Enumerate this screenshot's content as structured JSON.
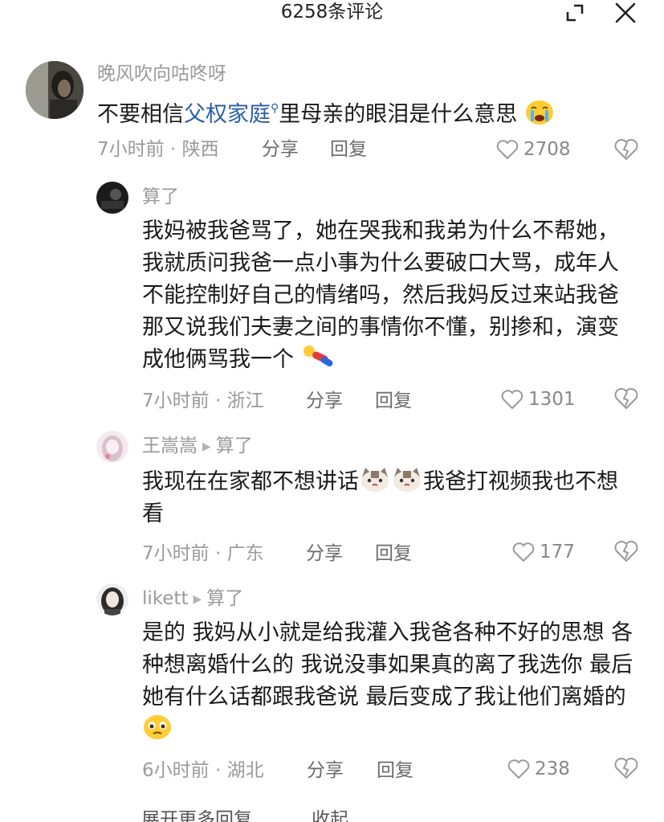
{
  "header": {
    "title": "6258条评论"
  },
  "comments": [
    {
      "user": "晚风吹向咕咚呀",
      "text_before": "不要相信",
      "keyword": "父权家庭",
      "text_after": "里母亲的眼泪是什么意思",
      "meta": "7小时前 · 陕西",
      "share": "分享",
      "reply": "回复",
      "likes": "2708"
    },
    {
      "user": "算了",
      "text": "我妈被我爸骂了，她在哭我和我弟为什么不帮她，我就质问我爸一点小事为什么要破口大骂，成年人不能控制好自己的情绪吗，然后我妈反过来站我爸那又说我们夫妻之间的事情你不懂，别掺和，演变成他俩骂我一个",
      "meta": "7小时前 · 浙江",
      "share": "分享",
      "reply": "回复",
      "likes": "1301"
    },
    {
      "user": "王嵩嵩",
      "reply_to": "算了",
      "text_before": "我现在在家都不想讲话",
      "text_after": "我爸打视频我也不想看",
      "meta": "7小时前 · 广东",
      "share": "分享",
      "reply": "回复",
      "likes": "177"
    },
    {
      "user": "likett",
      "reply_to": "算了",
      "text": "是的 我妈从小就是给我灌入我爸各种不好的思想 各种想离婚什么的 我说没事如果真的离了我选你 最后她有什么话都跟我爸说 最后变成了我让他们离婚的",
      "meta": "6小时前 · 湖北",
      "share": "分享",
      "reply": "回复",
      "likes": "238"
    }
  ],
  "footer": {
    "expand": "展开更多回复",
    "collapse": "收起"
  },
  "colors": {
    "keyword": "#2b5fa8",
    "meta": "#9a9a9a",
    "text": "#1a1a1a"
  }
}
